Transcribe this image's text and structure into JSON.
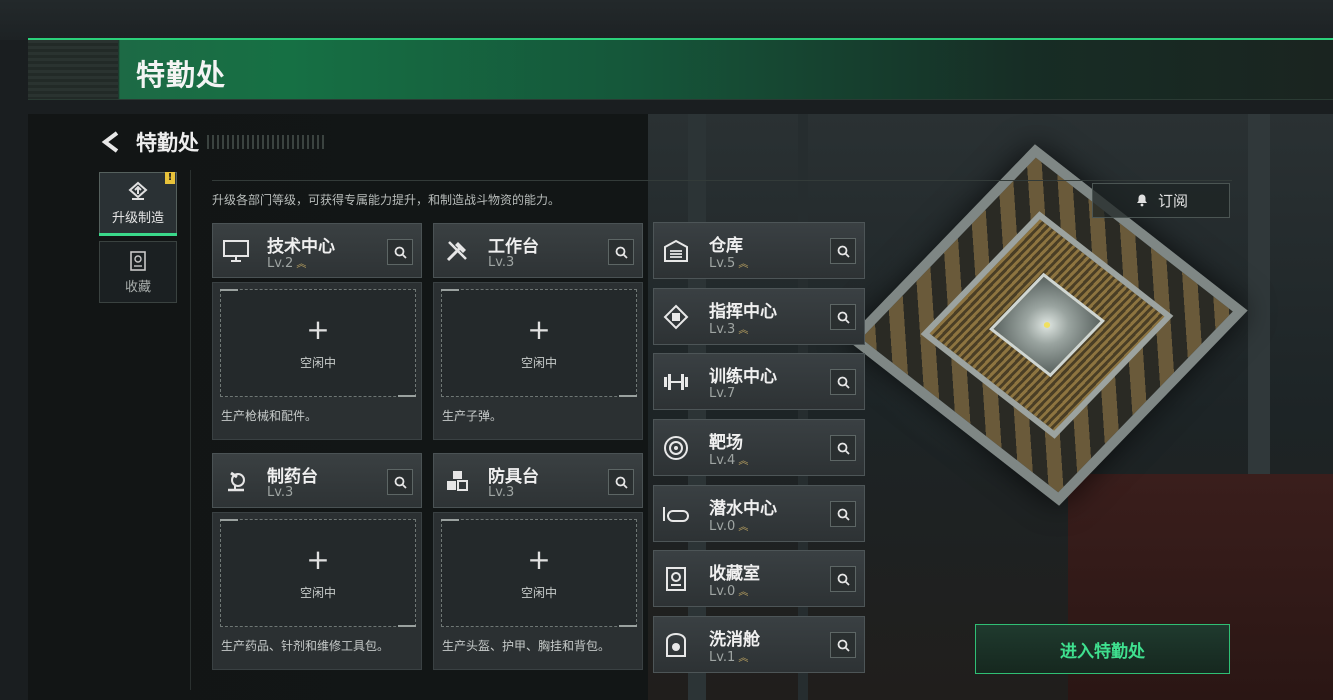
{
  "header": {
    "title": "特勤处"
  },
  "nav": {
    "back_title": "特勤处",
    "tabs": [
      {
        "label": "升级制造",
        "icon": "upgrade-icon",
        "active": true,
        "warn": "!"
      },
      {
        "label": "收藏",
        "icon": "collection-icon",
        "active": false
      }
    ]
  },
  "description": "升级各部门等级，可获得专属能力提升，和制造战斗物资的能力。",
  "subscribe_label": "订阅",
  "workbenches": [
    {
      "name": "技术中心",
      "level": "Lv.2",
      "icon": "monitor-icon",
      "slot_plus": "+",
      "slot_status": "空闲中",
      "produces": "生产枪械和配件。"
    },
    {
      "name": "工作台",
      "level": "Lv.3",
      "icon": "tools-icon",
      "slot_plus": "+",
      "slot_status": "空闲中",
      "produces": "生产子弹。"
    },
    {
      "name": "制药台",
      "level": "Lv.3",
      "icon": "microscope-icon",
      "slot_plus": "+",
      "slot_status": "空闲中",
      "produces": "生产药品、针剂和维修工具包。"
    },
    {
      "name": "防具台",
      "level": "Lv.3",
      "icon": "armor-cubes-icon",
      "slot_plus": "+",
      "slot_status": "空闲中",
      "produces": "生产头盔、护甲、胸挂和背包。"
    }
  ],
  "facilities": [
    {
      "name": "仓库",
      "level": "Lv.5",
      "icon": "warehouse-icon"
    },
    {
      "name": "指挥中心",
      "level": "Lv.3",
      "icon": "chip-icon"
    },
    {
      "name": "训练中心",
      "level": "Lv.7",
      "icon": "dumbbell-icon"
    },
    {
      "name": "靶场",
      "level": "Lv.4",
      "icon": "target-icon"
    },
    {
      "name": "潜水中心",
      "level": "Lv.0",
      "icon": "diving-mask-icon"
    },
    {
      "name": "收藏室",
      "level": "Lv.0",
      "icon": "vault-icon"
    },
    {
      "name": "洗消舱",
      "level": "Lv.1",
      "icon": "hazard-icon"
    }
  ],
  "enter_button": "进入特勤处",
  "colors": {
    "accent": "#2bd07a",
    "level_chevron": "#b8a060",
    "warn": "#e8c23a"
  }
}
